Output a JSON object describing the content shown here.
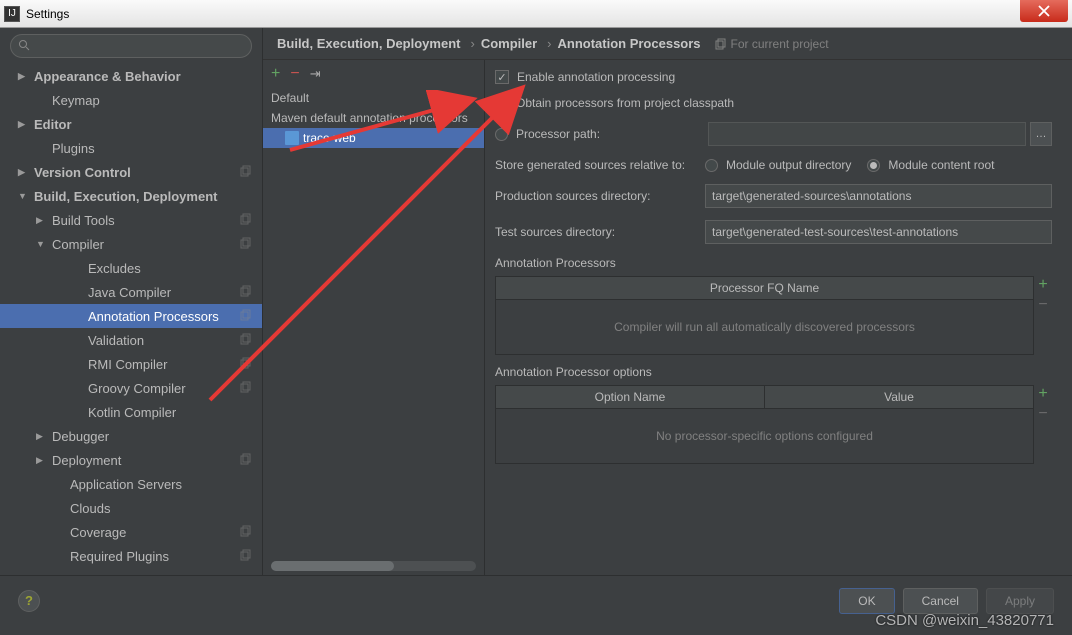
{
  "window": {
    "title": "Settings"
  },
  "breadcrumb": {
    "root": "Build, Execution, Deployment",
    "mid": "Compiler",
    "leaf": "Annotation Processors",
    "scope": "For current project"
  },
  "sidebar": {
    "search_placeholder": "",
    "items": [
      {
        "label": "Appearance & Behavior",
        "bold": true,
        "chev": "▶"
      },
      {
        "label": "Keymap",
        "indent": 1
      },
      {
        "label": "Editor",
        "bold": true,
        "chev": "▶"
      },
      {
        "label": "Plugins",
        "indent": 1
      },
      {
        "label": "Version Control",
        "bold": true,
        "chev": "▶",
        "copy": true
      },
      {
        "label": "Build, Execution, Deployment",
        "bold": true,
        "chev": "▼"
      },
      {
        "label": "Build Tools",
        "indent": 1,
        "chev": "▶",
        "copy": true
      },
      {
        "label": "Compiler",
        "indent": 1,
        "chev": "▼",
        "copy": true
      },
      {
        "label": "Excludes",
        "indent": 3
      },
      {
        "label": "Java Compiler",
        "indent": 3,
        "copy": true
      },
      {
        "label": "Annotation Processors",
        "indent": 3,
        "sel": true,
        "copy": true
      },
      {
        "label": "Validation",
        "indent": 3,
        "copy": true
      },
      {
        "label": "RMI Compiler",
        "indent": 3,
        "copy": true
      },
      {
        "label": "Groovy Compiler",
        "indent": 3,
        "copy": true
      },
      {
        "label": "Kotlin Compiler",
        "indent": 3
      },
      {
        "label": "Debugger",
        "indent": 1,
        "chev": "▶"
      },
      {
        "label": "Deployment",
        "indent": 1,
        "chev": "▶",
        "copy": true
      },
      {
        "label": "Application Servers",
        "indent": 2
      },
      {
        "label": "Clouds",
        "indent": 2
      },
      {
        "label": "Coverage",
        "indent": 2,
        "copy": true
      },
      {
        "label": "Required Plugins",
        "indent": 2,
        "copy": true
      }
    ]
  },
  "profiles": {
    "items": [
      "Default",
      "Maven default annotation processors",
      "trace-web"
    ]
  },
  "form": {
    "enable": "Enable annotation processing",
    "obtain": "Obtain processors from project classpath",
    "procpath": "Processor path:",
    "store": "Store generated sources relative to:",
    "store_opt1": "Module output directory",
    "store_opt2": "Module content root",
    "prod_dir_label": "Production sources directory:",
    "prod_dir": "target\\generated-sources\\annotations",
    "test_dir_label": "Test sources directory:",
    "test_dir": "target\\generated-test-sources\\test-annotations",
    "ap_title": "Annotation Processors",
    "ap_header": "Processor FQ Name",
    "ap_empty": "Compiler will run all automatically discovered processors",
    "opt_title": "Annotation Processor options",
    "opt_h1": "Option Name",
    "opt_h2": "Value",
    "opt_empty": "No processor-specific options configured"
  },
  "footer": {
    "ok": "OK",
    "cancel": "Cancel",
    "apply": "Apply"
  },
  "watermark": "CSDN @weixin_43820771"
}
